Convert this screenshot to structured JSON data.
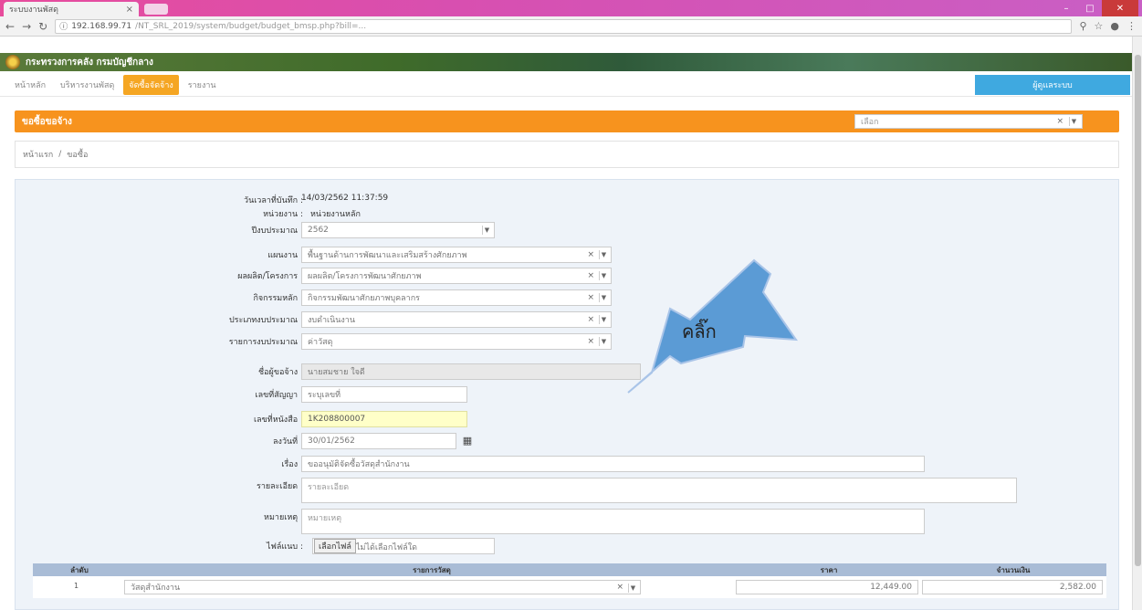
{
  "browser": {
    "tab_title": "ระบบงานพัสดุ",
    "url_host": "192.168.99.71",
    "url_path": "/NT_SRL_2019/system/budget/budget_bmsp.php?bill=..."
  },
  "site": {
    "banner_title": "กระทรวงการคลัง กรมบัญชีกลาง",
    "menu": [
      "หน้าหลัก",
      "บริหารงานพัสดุ",
      "จัดซื้อจัดจ้าง",
      "รายงาน"
    ],
    "menu_right": "ผู้ดูแลระบบ"
  },
  "section": {
    "title": "ขอซื้อขอจ้าง",
    "select_value": "เลือก"
  },
  "breadcrumb": [
    "หน้าแรก",
    "ขอซื้อ"
  ],
  "form": {
    "date_label": "วันเวลาที่บันทึก :",
    "date_value": "14/03/2562 11:37:59",
    "agency_label": "หน่วยงาน :",
    "agency_value": "หน่วยงานหลัก",
    "fiscal_year_label": "ปีงบประมาณ :",
    "fiscal_year_value": "2562",
    "plan_label": "แผนงาน :",
    "plan_value": "พื้นฐานด้านการพัฒนาและเสริมสร้างศักยภาพ",
    "project_label": "ผลผลิต/โครงการ :",
    "project_value": "ผลผลิต/โครงการพัฒนาศักยภาพ",
    "activity_label": "กิจกรรมหลัก :",
    "activity_value": "กิจกรรมพัฒนาศักยภาพบุคลากร",
    "budget_type_label": "ประเภทงบประมาณ :",
    "budget_type_value": "งบดำเนินงาน",
    "budget_item_label": "รายการงบประมาณ :",
    "budget_item_value": "ค่าวัสดุ",
    "requester_label": "ชื่อผู้ขอจ้าง :",
    "requester_value": "นายสมชาย ใจดี",
    "contract_label": "เลขที่สัญญา :",
    "contract_placeholder": "ระบุเลขที่",
    "doc_no_label": "เลขที่หนังสือ :",
    "doc_no_value": "1K208800007",
    "doc_date_label": "ลงวันที่ :",
    "doc_date_value": "30/01/2562",
    "subject_label": "เรื่อง :",
    "subject_value": "ขออนุมัติจัดซื้อวัสดุสำนักงาน",
    "reason_label": "รายละเอียด :",
    "reason_placeholder": "รายละเอียด",
    "note_label": "หมายเหตุ :",
    "note_placeholder": "หมายเหตุ",
    "attach_label": "ไฟล์แนบ :",
    "attach_button": "เลือกไฟล์",
    "attach_text": "ไม่ได้เลือกไฟล์ใด"
  },
  "table": {
    "headers": [
      "ลำดับ",
      "รายการวัสดุ",
      "ราคา",
      "จำนวนเงิน"
    ],
    "rows": [
      {
        "no": "1",
        "item": "วัสดุสำนักงาน",
        "price": "12,449.00",
        "amount": "2,582.00"
      }
    ]
  },
  "callout": {
    "text": "คลิ๊ก",
    "color": "#5b9bd5"
  }
}
